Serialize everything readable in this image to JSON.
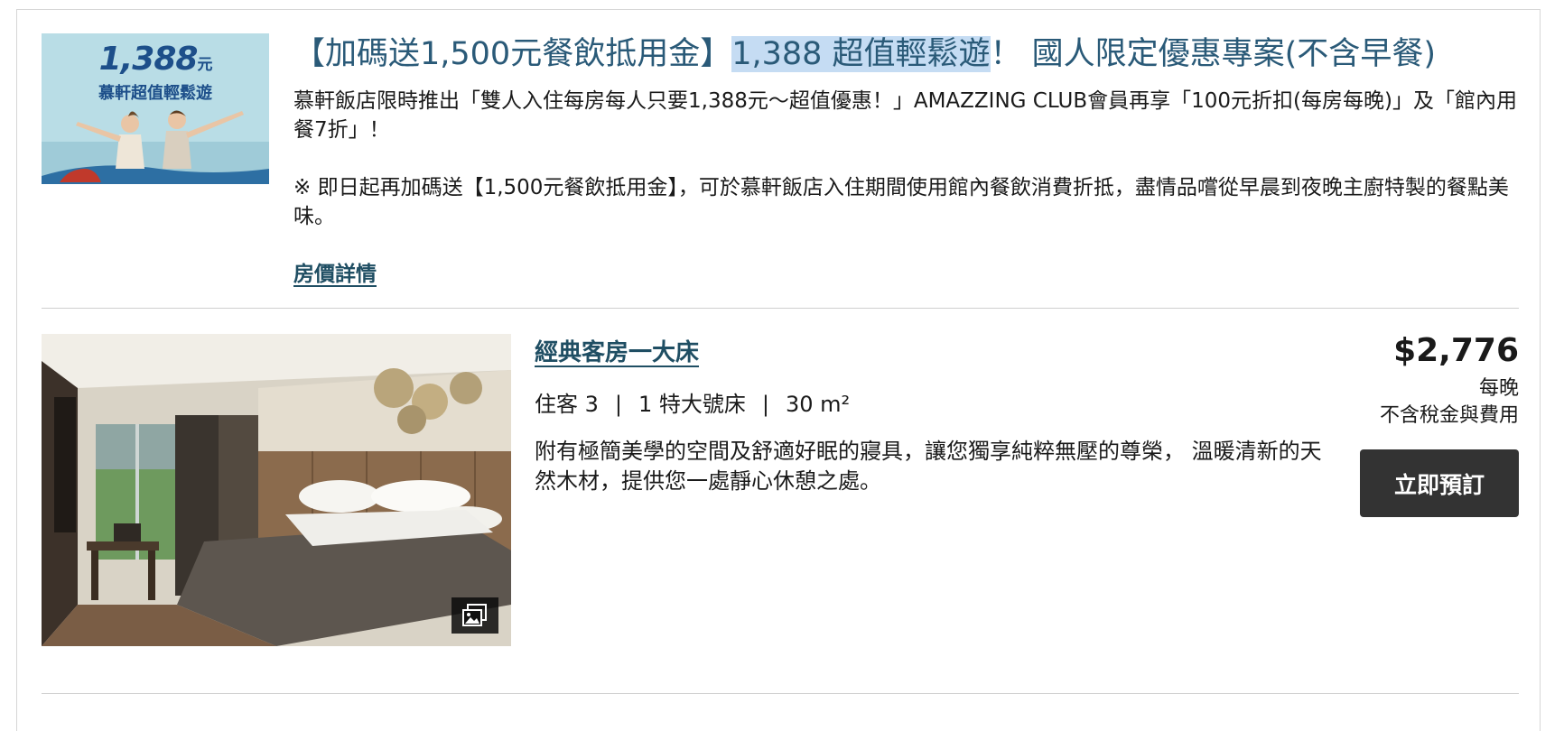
{
  "offer": {
    "thumb_price": "1,388",
    "thumb_price_unit": "元",
    "thumb_tagline": "慕軒超值輕鬆遊",
    "title_part1": "【加碼送1,500元餐飲抵用金】",
    "title_highlight": "1,388 超值輕鬆遊",
    "title_part2": "！ 國人限定優惠專案(不含早餐)",
    "desc_paragraph1": "慕軒飯店限時推出「雙人入住每房每人只要1,388元～超值優惠！」AMAZZING CLUB會員再享「100元折扣(每房每晚)」及「館內用餐7折」！",
    "desc_paragraph2": "※ 即日起再加碼送【1,500元餐飲抵用金】，可於慕軒飯店入住期間使用館內餐飲消費折抵，盡情品嚐從早晨到夜晚主廚特製的餐點美味。",
    "details_link": "房價詳情"
  },
  "room": {
    "name": "經典客房一大床",
    "guests": "住客 3",
    "bed": "1 特大號床",
    "size": "30 m²",
    "separator": "|",
    "description": "附有極簡美學的空間及舒適好眠的寢具，讓您獨享純粹無壓的尊榮， 溫暖清新的天然木材，提供您一處靜心休憩之處。",
    "gallery_icon": "gallery-icon"
  },
  "pricing": {
    "amount": "$2,776",
    "per": "每晚",
    "note": "不含稅金與費用",
    "book_button": "立即預訂"
  },
  "colors": {
    "title": "#2a5a78",
    "link": "#1f4e63",
    "highlight": "#c5dcf3",
    "button": "#333333"
  }
}
